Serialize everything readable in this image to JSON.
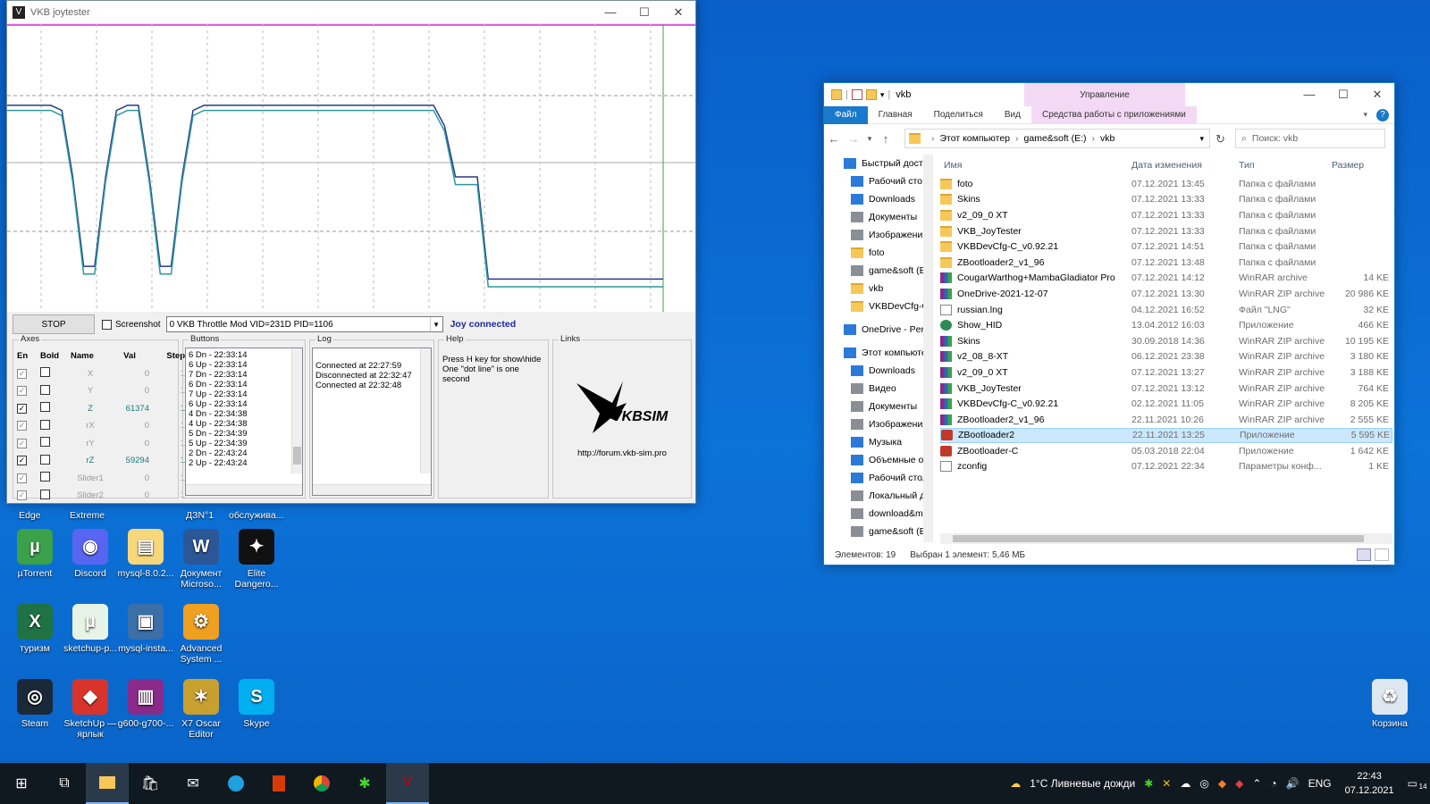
{
  "joytester": {
    "title": "VKB joytester",
    "stop_label": "STOP",
    "screenshot_label": "Screenshot",
    "device": "0 VKB Throttle Mod VID=231D PID=1106",
    "status": "Joy connected",
    "axes": {
      "title": "Axes",
      "headers": {
        "en": "En",
        "bold": "Bold",
        "name": "Name",
        "val": "Val",
        "step": "Step"
      },
      "rows": [
        {
          "name": "X",
          "val": "0",
          "step": "1",
          "enabled": false
        },
        {
          "name": "Y",
          "val": "0",
          "step": "1",
          "enabled": false
        },
        {
          "name": "Z",
          "val": "61374",
          "step": "1",
          "enabled": true
        },
        {
          "name": "rX",
          "val": "0",
          "step": "1",
          "enabled": false
        },
        {
          "name": "rY",
          "val": "0",
          "step": "1",
          "enabled": false
        },
        {
          "name": "rZ",
          "val": "59294",
          "step": "1",
          "enabled": true
        },
        {
          "name": "Slider1",
          "val": "0",
          "step": "1",
          "enabled": false
        },
        {
          "name": "Slider2",
          "val": "0",
          "step": "1",
          "enabled": false
        }
      ]
    },
    "buttons": {
      "title": "Buttons",
      "lines": [
        "6 Dn - 22:33:14",
        "6 Up - 22:33:14",
        "7 Dn - 22:33:14",
        "6 Dn - 22:33:14",
        "7 Up - 22:33:14",
        "6 Up - 22:33:14",
        "4 Dn - 22:34:38",
        "4 Up - 22:34:38",
        "5 Dn - 22:34:39",
        "5 Up - 22:34:39",
        "2 Dn - 22:43:24",
        "2 Up - 22:43:24"
      ]
    },
    "log": {
      "title": "Log",
      "lines": [
        "Connected at 22:27:59",
        "Disconnected at 22:32:47",
        "Connected at 22:32:48"
      ]
    },
    "help": {
      "title": "Help",
      "lines": [
        "Press H key for show\\hide",
        "One \"dot line\" is one second"
      ]
    },
    "links": {
      "title": "Links",
      "url": "http://forum.vkb-sim.pro",
      "logo_text": "VKBSIM"
    }
  },
  "explorer": {
    "title": "vkb",
    "manage_label": "Управление",
    "ribbon_tabs": [
      "Файл",
      "Главная",
      "Поделиться",
      "Вид",
      "Средства работы с приложениями"
    ],
    "address": [
      "Этот компьютер",
      "game&soft (E:)",
      "vkb"
    ],
    "search_placeholder": "Поиск: vkb",
    "nav_items": [
      {
        "label": "Быстрый доступ",
        "icon": "star-icon"
      },
      {
        "label": "Рабочий сто",
        "icon": "desktop-icon"
      },
      {
        "label": "Downloads",
        "icon": "download-icon"
      },
      {
        "label": "Документы",
        "icon": "document-icon"
      },
      {
        "label": "Изображени",
        "icon": "image-icon"
      },
      {
        "label": "foto",
        "icon": "folder-icon"
      },
      {
        "label": "game&soft (E:)",
        "icon": "drive-icon"
      },
      {
        "label": "vkb",
        "icon": "folder-icon"
      },
      {
        "label": "VKBDevCfg-C_vi",
        "icon": "folder-icon"
      },
      {
        "label": "OneDrive - Persor",
        "icon": "cloud-icon"
      },
      {
        "label": "Этот компьютер",
        "icon": "computer-icon"
      },
      {
        "label": "Downloads",
        "icon": "download-icon"
      },
      {
        "label": "Видео",
        "icon": "video-icon"
      },
      {
        "label": "Документы",
        "icon": "document-icon"
      },
      {
        "label": "Изображения",
        "icon": "image-icon"
      },
      {
        "label": "Музыка",
        "icon": "music-icon"
      },
      {
        "label": "Объемные объ",
        "icon": "cube-icon"
      },
      {
        "label": "Рабочий стол",
        "icon": "desktop-icon"
      },
      {
        "label": "Локальный дис",
        "icon": "drive-icon"
      },
      {
        "label": "download&mult",
        "icon": "drive-icon"
      },
      {
        "label": "game&soft (E:)",
        "icon": "drive-icon"
      }
    ],
    "columns": {
      "name": "Имя",
      "date": "Дата изменения",
      "type": "Тип",
      "size": "Размер"
    },
    "files": [
      {
        "name": "foto",
        "date": "07.12.2021 13:45",
        "type": "Папка с файлами",
        "size": "",
        "icon": "folder"
      },
      {
        "name": "Skins",
        "date": "07.12.2021 13:33",
        "type": "Папка с файлами",
        "size": "",
        "icon": "folder"
      },
      {
        "name": "v2_09_0 XT",
        "date": "07.12.2021 13:33",
        "type": "Папка с файлами",
        "size": "",
        "icon": "folder"
      },
      {
        "name": "VKB_JoyTester",
        "date": "07.12.2021 13:33",
        "type": "Папка с файлами",
        "size": "",
        "icon": "folder"
      },
      {
        "name": "VKBDevCfg-C_v0.92.21",
        "date": "07.12.2021 14:51",
        "type": "Папка с файлами",
        "size": "",
        "icon": "folder"
      },
      {
        "name": "ZBootloader2_v1_96",
        "date": "07.12.2021 13:48",
        "type": "Папка с файлами",
        "size": "",
        "icon": "folder"
      },
      {
        "name": "CougarWarthog+MambaGladiator Pro",
        "date": "07.12.2021 14:12",
        "type": "WinRAR archive",
        "size": "14 KE",
        "icon": "rar"
      },
      {
        "name": "OneDrive-2021-12-07",
        "date": "07.12.2021 13:30",
        "type": "WinRAR ZIP archive",
        "size": "20 986 KE",
        "icon": "rar"
      },
      {
        "name": "russian.lng",
        "date": "04.12.2021 16:52",
        "type": "Файл \"LNG\"",
        "size": "32 KE",
        "icon": "file"
      },
      {
        "name": "Show_HID",
        "date": "13.04.2012 16:03",
        "type": "Приложение",
        "size": "466 KE",
        "icon": "hid"
      },
      {
        "name": "Skins",
        "date": "30.09.2018 14:36",
        "type": "WinRAR ZIP archive",
        "size": "10 195 KE",
        "icon": "rar"
      },
      {
        "name": "v2_08_8-XT",
        "date": "06.12.2021 23:38",
        "type": "WinRAR ZIP archive",
        "size": "3 180 KE",
        "icon": "rar"
      },
      {
        "name": "v2_09_0 XT",
        "date": "07.12.2021 13:27",
        "type": "WinRAR ZIP archive",
        "size": "3 188 KE",
        "icon": "rar"
      },
      {
        "name": "VKB_JoyTester",
        "date": "07.12.2021 13:12",
        "type": "WinRAR ZIP archive",
        "size": "764 KE",
        "icon": "rar"
      },
      {
        "name": "VKBDevCfg-C_v0.92.21",
        "date": "02.12.2021 11:05",
        "type": "WinRAR ZIP archive",
        "size": "8 205 KE",
        "icon": "rar"
      },
      {
        "name": "ZBootloader2_v1_96",
        "date": "22.11.2021 10:26",
        "type": "WinRAR ZIP archive",
        "size": "2 555 KE",
        "icon": "rar"
      },
      {
        "name": "ZBootloader2",
        "date": "22.11.2021 13:25",
        "type": "Приложение",
        "size": "5 595 KE",
        "icon": "app",
        "selected": true
      },
      {
        "name": "ZBootloader-C",
        "date": "05.03.2018 22:04",
        "type": "Приложение",
        "size": "1 642 KE",
        "icon": "app"
      },
      {
        "name": "zconfig",
        "date": "07.12.2021 22:34",
        "type": "Параметры конф...",
        "size": "1 KE",
        "icon": "file"
      }
    ],
    "status_count": "Элементов: 19",
    "status_selected": "Выбран 1 элемент: 5,46 МБ"
  },
  "desktop": {
    "partial_labels": [
      "Edge",
      "Extreme",
      "ДЗN°1",
      "обслужива..."
    ],
    "icons": [
      {
        "label": "µTorrent",
        "icon": "utorrent-icon",
        "color": "#3aa04a",
        "glyph": "µ"
      },
      {
        "label": "Discord",
        "icon": "discord-icon",
        "color": "#5865f2",
        "glyph": "◉"
      },
      {
        "label": "mysql-8.0.2...",
        "icon": "folder-zip-icon",
        "color": "#f6d77a",
        "glyph": "▤"
      },
      {
        "label": "Документ Microso...",
        "icon": "word-icon",
        "color": "#2b5797",
        "glyph": "W"
      },
      {
        "label": "Elite Dangero...",
        "icon": "elite-icon",
        "color": "#111111",
        "glyph": "✦"
      },
      {
        "label": "туризм",
        "icon": "excel-icon",
        "color": "#1f7244",
        "glyph": "X"
      },
      {
        "label": "sketchup-p...",
        "icon": "torrent-file-icon",
        "color": "#e8f3e8",
        "glyph": "µ"
      },
      {
        "label": "mysql-insta...",
        "icon": "installer-icon",
        "color": "#3b6fa8",
        "glyph": "▣"
      },
      {
        "label": "Advanced System ...",
        "icon": "advanced-systemcare-icon",
        "color": "#f0a020",
        "glyph": "⚙"
      },
      {
        "label": "Steam",
        "icon": "steam-icon",
        "color": "#1b2838",
        "glyph": "◎"
      },
      {
        "label": "SketchUp — ярлык",
        "icon": "sketchup-icon",
        "color": "#d9342b",
        "glyph": "◆"
      },
      {
        "label": "g600-g700-...",
        "icon": "winrar-icon",
        "color": "#8a2a8a",
        "glyph": "▥"
      },
      {
        "label": "X7 Oscar Editor",
        "icon": "oscar-editor-icon",
        "color": "#c8a030",
        "glyph": "✶"
      },
      {
        "label": "Skype",
        "icon": "skype-icon",
        "color": "#00aff0",
        "glyph": "S"
      },
      {
        "label": "Корзина",
        "icon": "recycle-bin-icon",
        "color": "#dfe8f0",
        "glyph": "♻"
      }
    ]
  },
  "taskbar": {
    "weather": "1°C  Ливневые дожди",
    "lang": "ENG",
    "time": "22:43",
    "date": "07.12.2021",
    "notification_count": "14"
  },
  "chart_data": {
    "type": "line",
    "series": [
      {
        "values": [
          0.78,
          0.78,
          0.78,
          0.78,
          0.78,
          0.76,
          0.5,
          0.15,
          0.15,
          0.5,
          0.76,
          0.78,
          0.78,
          0.5,
          0.15,
          0.15,
          0.5,
          0.76,
          0.78,
          0.78,
          0.78,
          0.78,
          0.78,
          0.78,
          0.78,
          0.78,
          0.78,
          0.78,
          0.78,
          0.78,
          0.78,
          0.78,
          0.78,
          0.78,
          0.78,
          0.78,
          0.78,
          0.78,
          0.78,
          0.78,
          0.7,
          0.5,
          0.5,
          0.5,
          0.1,
          0.1,
          0.1,
          0.1,
          0.1,
          0.1,
          0.1,
          0.1,
          0.1,
          0.1,
          0.1,
          0.1,
          0.1,
          0.1,
          0.1,
          0.1,
          0.1
        ]
      },
      {
        "values": [
          0.76,
          0.76,
          0.76,
          0.76,
          0.76,
          0.74,
          0.48,
          0.12,
          0.12,
          0.48,
          0.74,
          0.76,
          0.76,
          0.48,
          0.12,
          0.12,
          0.48,
          0.74,
          0.76,
          0.76,
          0.76,
          0.76,
          0.76,
          0.76,
          0.76,
          0.76,
          0.76,
          0.76,
          0.76,
          0.76,
          0.76,
          0.76,
          0.76,
          0.76,
          0.76,
          0.76,
          0.76,
          0.76,
          0.76,
          0.76,
          0.68,
          0.47,
          0.47,
          0.47,
          0.07,
          0.07,
          0.07,
          0.07,
          0.07,
          0.07,
          0.07,
          0.07,
          0.07,
          0.07,
          0.07,
          0.07,
          0.07,
          0.07,
          0.07,
          0.07,
          0.07
        ]
      }
    ]
  }
}
